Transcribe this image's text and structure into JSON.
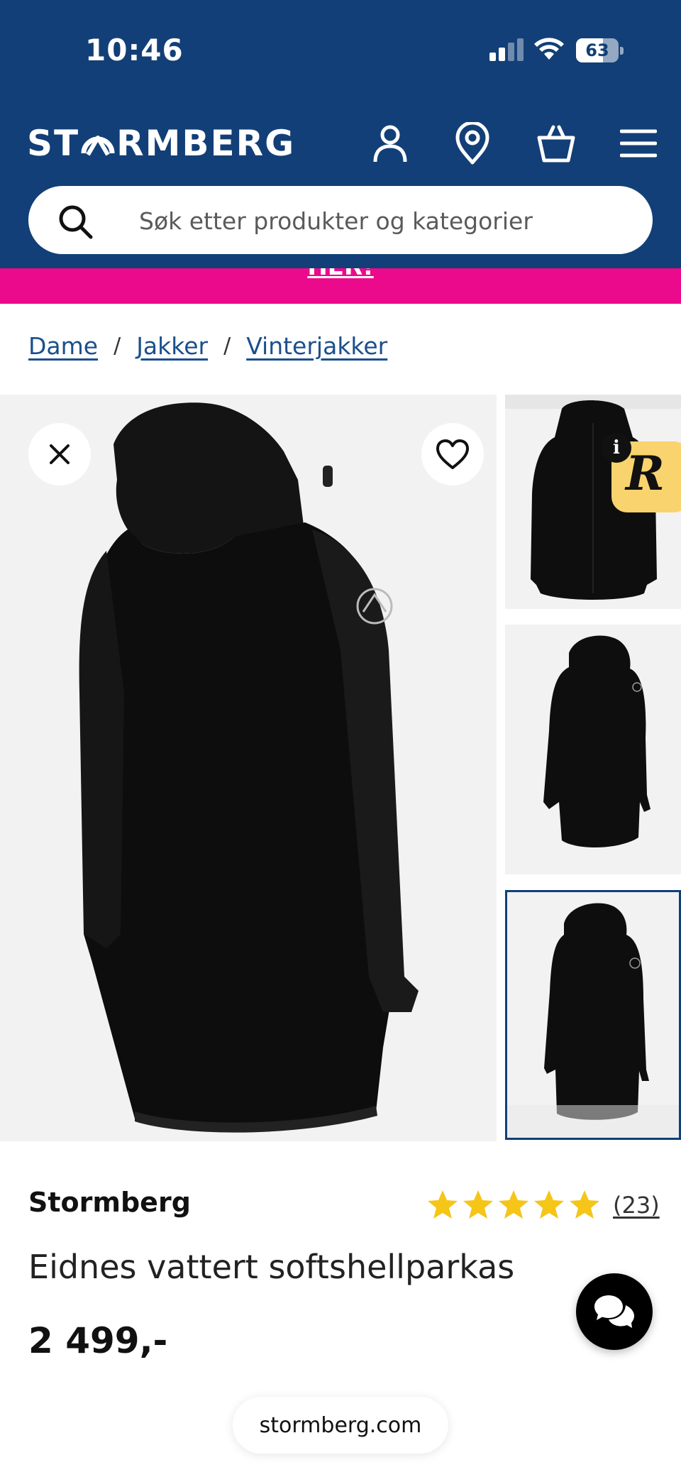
{
  "status_bar": {
    "time": "10:46",
    "battery": "63"
  },
  "header": {
    "logo_text_left": "ST",
    "logo_text_right": "RMBERG",
    "brand_color": "#123f77",
    "icons": [
      "account-icon",
      "store-locator-icon",
      "cart-icon",
      "menu-icon"
    ]
  },
  "search": {
    "placeholder": "Søk etter produkter og kategorier"
  },
  "promo": {
    "text": "HER!",
    "color": "#ec0a8c"
  },
  "breadcrumb": {
    "items": [
      "Dame",
      "Jakker",
      "Vinterjakker"
    ],
    "separator": "/"
  },
  "gallery": {
    "thumbnail_count": 3,
    "selected_thumbnail": 3
  },
  "reward_badge": {
    "info": "i",
    "letter": "R"
  },
  "product": {
    "brand": "Stormberg",
    "name": "Eidnes vattert softshellparkas",
    "price": "2 499,-",
    "rating_stars": 5,
    "review_count": "(23)",
    "star_color": "#f5c518"
  },
  "browser": {
    "url": "stormberg.com"
  }
}
